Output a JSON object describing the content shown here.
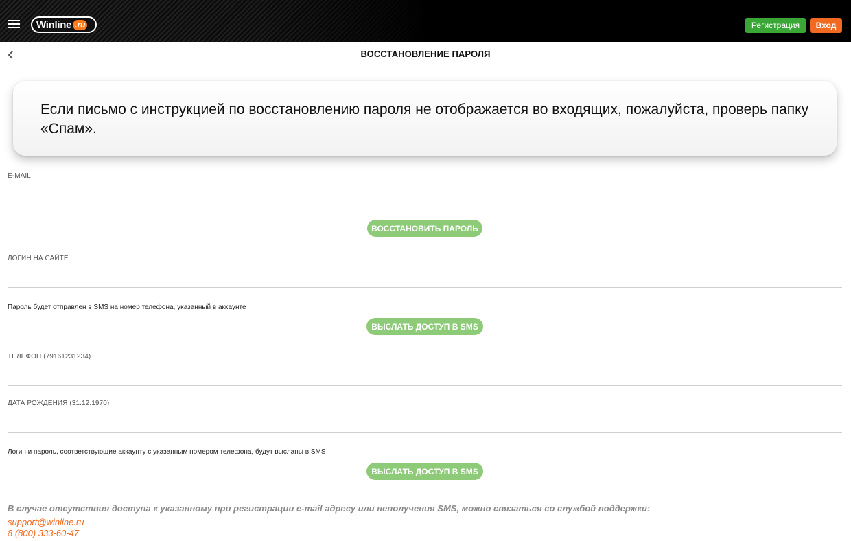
{
  "header": {
    "logo_brand": "Winline",
    "logo_tld": ".ru",
    "register_label": "Регистрация",
    "login_label": "Вход"
  },
  "subheader": {
    "title": "ВОССТАНОВЛЕНИЕ ПАРОЛЯ"
  },
  "notice": {
    "text": "Если письмо с инструкцией по восстановлению пароля не отображается во входящих, пожалуйста, проверь папку «Спам»."
  },
  "email_section": {
    "label": "E-MAIL",
    "value": "",
    "button_label": "ВОССТАНОВИТЬ ПАРОЛЬ"
  },
  "login_section": {
    "label": "ЛОГИН НА САЙТЕ",
    "value": "",
    "hint": "Пароль будет отправлен в SMS на номер телефона, указанный в аккаунте",
    "button_label": "ВЫСЛАТЬ ДОСТУП В SMS"
  },
  "phone_section": {
    "phone_label": "ТЕЛЕФОН (79161231234)",
    "phone_value": "",
    "birth_label": "ДАТА РОЖДЕНИЯ (31.12.1970)",
    "birth_value": "",
    "hint": "Логин и пароль, соответствующие аккаунту с указанным номером телефона, будут высланы в SMS",
    "button_label": "ВЫСЛАТЬ ДОСТУП В SMS"
  },
  "footer": {
    "text": "В случае отсутствия доступа к указанному при регистрации e-mail адресу или неполучения SMS, можно связаться со службой поддержки:",
    "email": "support@winline.ru",
    "phone": "8 (800) 333-60-47"
  },
  "colors": {
    "header_bg": "#000000",
    "register_green": "#3aa635",
    "login_orange": "#f26a21",
    "action_green": "#8ecb79",
    "link_orange": "#f26a21"
  },
  "icons": [
    "menu-icon",
    "back-icon"
  ]
}
